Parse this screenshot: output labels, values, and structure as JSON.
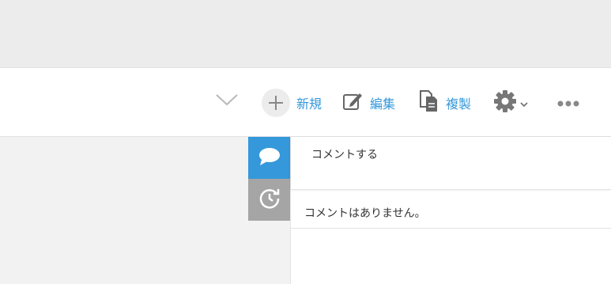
{
  "toolbar": {
    "new_label": "新規",
    "edit_label": "編集",
    "copy_label": "複製"
  },
  "side_panel": {
    "comment_placeholder": "コメントする",
    "empty_message": "コメントはありません。"
  },
  "colors": {
    "accent": "#3498db",
    "history_tab": "#a5a5a5",
    "icon_gray": "#666666",
    "chevron": "#b8b8b8"
  },
  "icons": {
    "chevron": "chevron-down-icon",
    "new": "plus-icon",
    "edit": "pencil-square-icon",
    "copy": "document-copy-icon",
    "settings": "gear-icon",
    "more": "more-dots-icon",
    "comment_tab": "speech-bubble-icon",
    "history_tab": "history-icon"
  }
}
